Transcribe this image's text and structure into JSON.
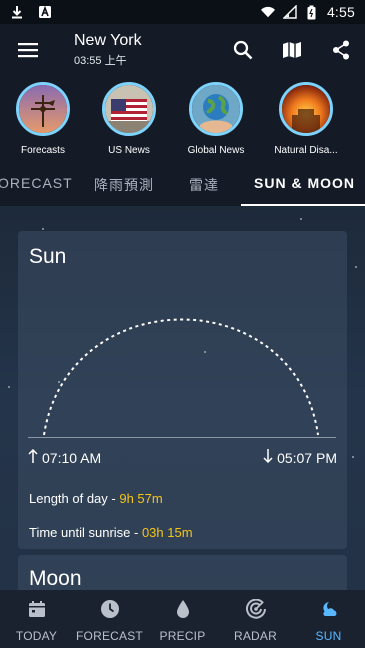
{
  "status_bar": {
    "time": "4:55"
  },
  "header": {
    "city": "New York",
    "local_time": "03:55 上午"
  },
  "news": [
    {
      "label": "Forecasts",
      "icon": "weathervane-thumbnail"
    },
    {
      "label": "US News",
      "icon": "us-flag-thumbnail"
    },
    {
      "label": "Global News",
      "icon": "globe-thumbnail"
    },
    {
      "label": "Natural Disa...",
      "icon": "fire-thumbnail"
    }
  ],
  "tabs": [
    {
      "label": "ORECAST"
    },
    {
      "label": "降雨預測"
    },
    {
      "label": "雷達"
    },
    {
      "label": "SUN & MOON",
      "active": true
    }
  ],
  "sun": {
    "title": "Sun",
    "sunrise": "07:10 AM",
    "sunset": "05:07 PM",
    "length_label": "Length of day - ",
    "length_value": "9h 57m",
    "until_label": "Time until sunrise - ",
    "until_value": "03h 15m"
  },
  "moon": {
    "title": "Moon"
  },
  "bottom_nav": [
    {
      "label": "TODAY"
    },
    {
      "label": "FORECAST"
    },
    {
      "label": "PRECIP"
    },
    {
      "label": "RADAR"
    },
    {
      "label": "SUN",
      "active": true
    }
  ],
  "colors": {
    "accent": "#58b8ff",
    "highlight": "#f5c518",
    "ring": "#7dd3fc"
  }
}
